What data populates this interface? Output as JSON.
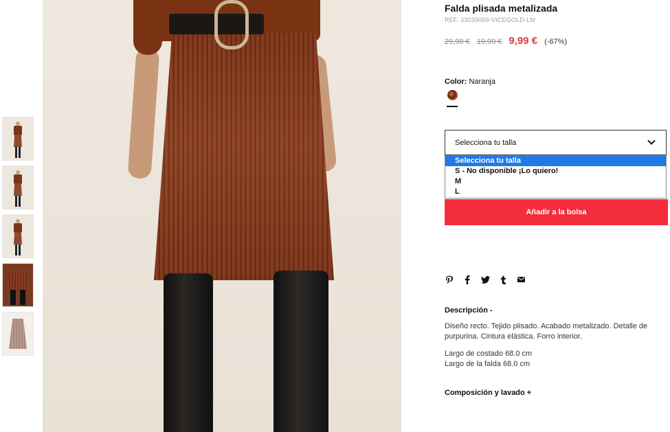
{
  "product": {
    "title": "Falda plisada metalizada",
    "ref": "REF. 33039059-VICEGOLD-LM",
    "price_original": "29,99 €",
    "price_previous": "19,99 €",
    "price_current": "9,99 €",
    "discount": "(-67%)",
    "accent_color": "#e03a3e"
  },
  "color": {
    "label": "Color:",
    "value": "Naranja"
  },
  "size": {
    "select_label": "Selecciona tu talla",
    "options": [
      "Selecciona tu talla",
      "S - No disponible ¡Lo quiero!",
      "M",
      "L"
    ],
    "highlight_color": "#1e7ae6"
  },
  "actions": {
    "add_to_bag": "Añadir a la bolsa",
    "button_color": "#f42d3a"
  },
  "social": {
    "icons": [
      "pinterest-icon",
      "facebook-icon",
      "twitter-icon",
      "tumblr-icon",
      "email-icon"
    ]
  },
  "description": {
    "title": "Descripción -",
    "text": "Diseño recto. Tejido plisado. Acabado metalizado. Detalle de purpurina. Cintura elástica. Forro interior.",
    "side_length": "Largo de costado 68.0 cm",
    "skirt_length": "Largo de la falda 68.0 cm"
  },
  "composition": {
    "title": "Composición y lavado +"
  },
  "gallery": {
    "thumbnails": [
      "thumb-model-front",
      "thumb-model-side",
      "thumb-model-back",
      "thumb-closeup",
      "thumb-flat"
    ]
  }
}
